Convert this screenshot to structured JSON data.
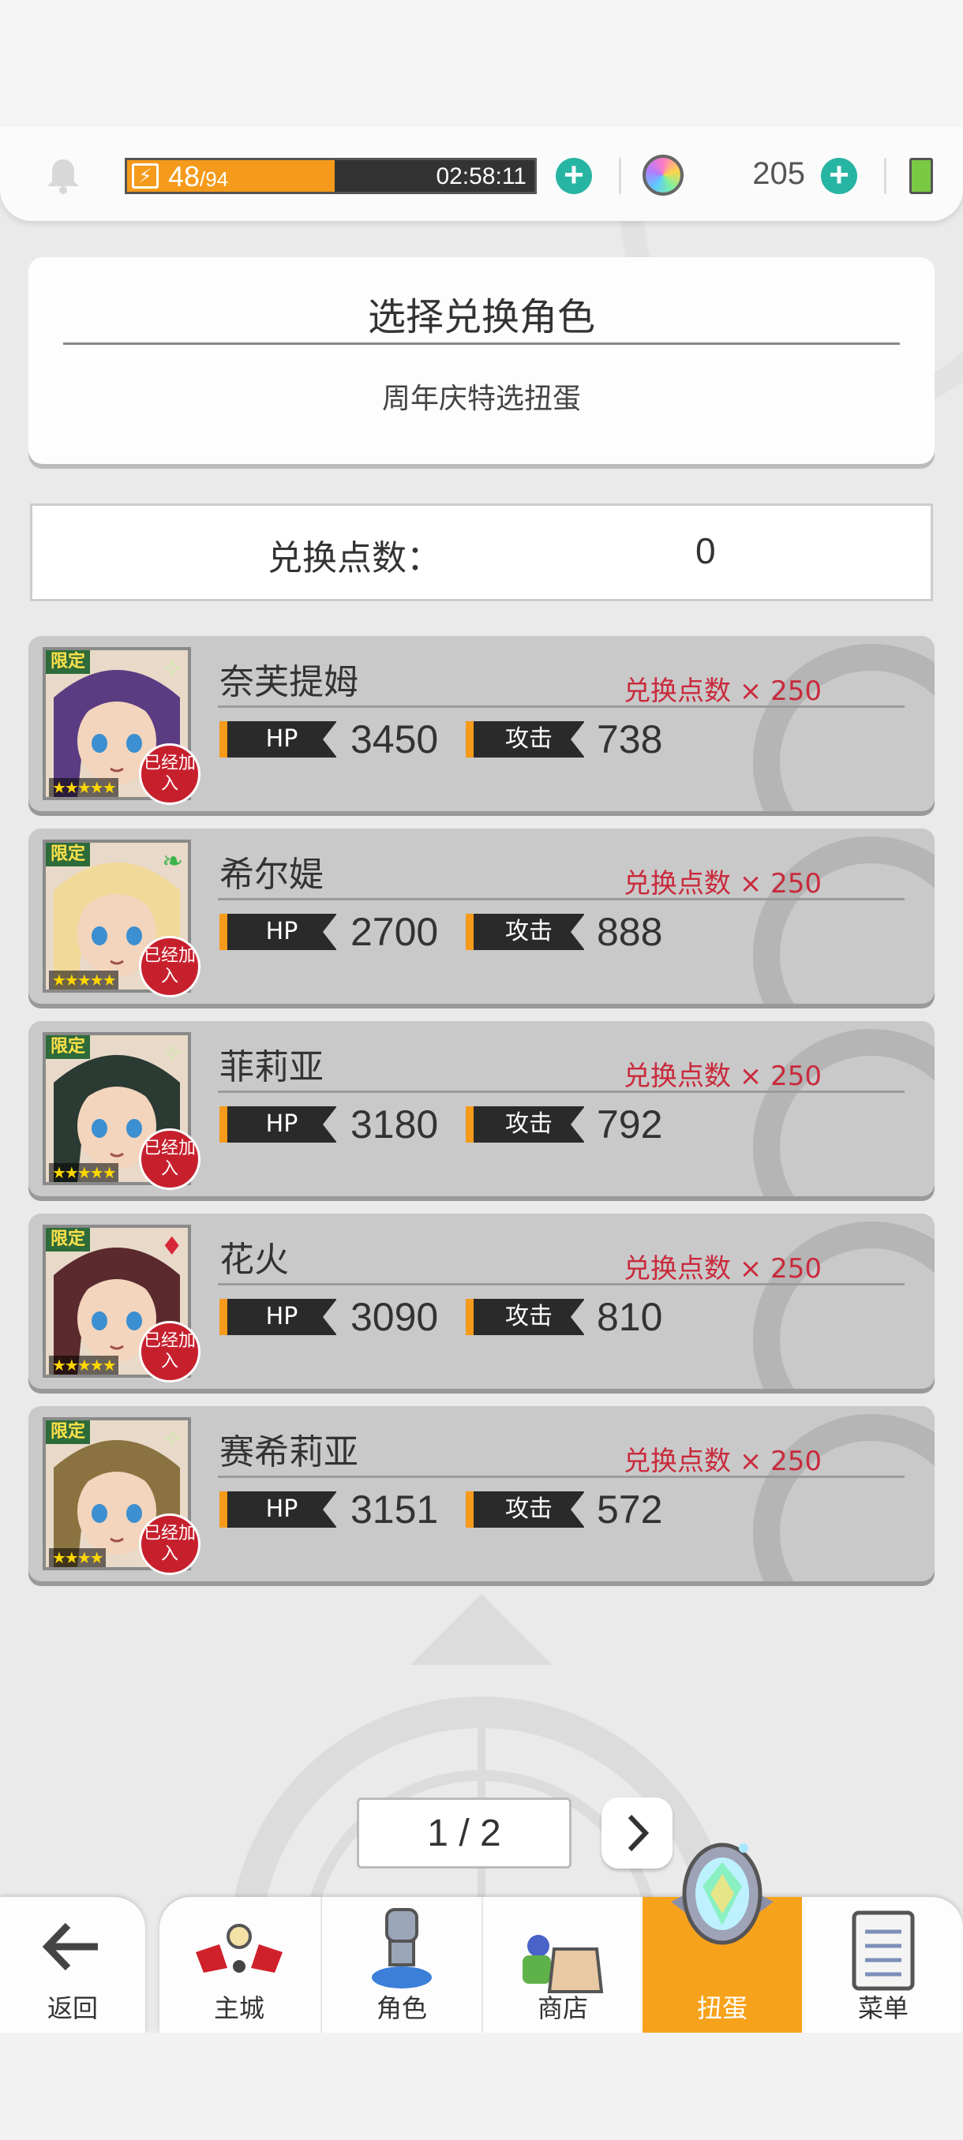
{
  "status_bar": {
    "stamina_current": "48",
    "stamina_max": "/94",
    "stamina_fraction": 0.51,
    "timer": "02:58:11",
    "gem_count": "205"
  },
  "header": {
    "title": "选择兑换角色",
    "subtitle": "周年庆特选扭蛋"
  },
  "points": {
    "label": "兑换点数：",
    "value": "0"
  },
  "characters": [
    {
      "name": "奈芙提姆",
      "cost": "兑换点数 × 250",
      "hp_label": "HP",
      "hp": "3450",
      "atk_label": "攻击",
      "atk": "738",
      "limited": "限定",
      "joined": "已经加入",
      "stars": "★★★★★",
      "element_icon": "wind-star-icon",
      "element_glyph": "✧",
      "element_color": "#d4e8b0",
      "hair_color": "#5b3c82"
    },
    {
      "name": "希尔媞",
      "cost": "兑换点数 × 250",
      "hp_label": "HP",
      "hp": "2700",
      "atk_label": "攻击",
      "atk": "888",
      "limited": "限定",
      "joined": "已经加入",
      "stars": "★★★★★",
      "element_icon": "leaf-icon",
      "element_glyph": "❧",
      "element_color": "#3cb44b",
      "hair_color": "#f1d99a"
    },
    {
      "name": "菲莉亚",
      "cost": "兑换点数 × 250",
      "hp_label": "HP",
      "hp": "3180",
      "atk_label": "攻击",
      "atk": "792",
      "limited": "限定",
      "joined": "已经加入",
      "stars": "★★★★★",
      "element_icon": "wind-star-icon",
      "element_glyph": "✧",
      "element_color": "#d4e8b0",
      "hair_color": "#2b3a33"
    },
    {
      "name": "花火",
      "cost": "兑换点数 × 250",
      "hp_label": "HP",
      "hp": "3090",
      "atk_label": "攻击",
      "atk": "810",
      "limited": "限定",
      "joined": "已经加入",
      "stars": "★★★★★",
      "element_icon": "fire-diamond-icon",
      "element_glyph": "♦",
      "element_color": "#d6283a",
      "hair_color": "#5a2a2e"
    },
    {
      "name": "赛希莉亚",
      "cost": "兑换点数 × 250",
      "hp_label": "HP",
      "hp": "3151",
      "atk_label": "攻击",
      "atk": "572",
      "limited": "限定",
      "joined": "已经加入",
      "stars": "★★★★",
      "element_icon": "wind-star-icon",
      "element_glyph": "✧",
      "element_color": "#d4e8b0",
      "hair_color": "#8a7340"
    }
  ],
  "pagination": {
    "text": "1 / 2"
  },
  "nav": {
    "back": "返回",
    "items": [
      "主城",
      "角色",
      "商店",
      "扭蛋",
      "菜单"
    ]
  }
}
